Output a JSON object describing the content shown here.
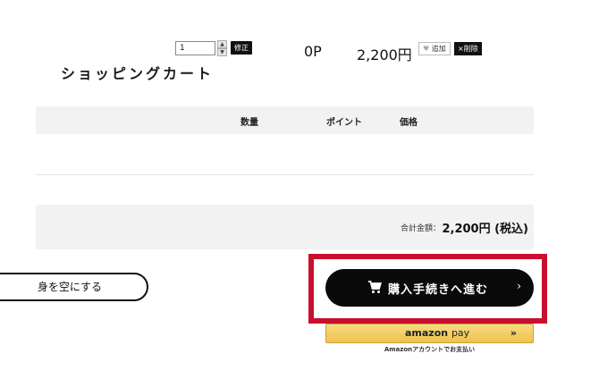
{
  "page": {
    "title": "ショッピングカート"
  },
  "table": {
    "headers": {
      "quantity": "数量",
      "points": "ポイント",
      "price": "価格"
    },
    "items": [
      {
        "quantity": "1",
        "update_label": "修正",
        "points": "0P",
        "price": "2,200円",
        "favorite_label": "追加",
        "delete_label": "×削除"
      }
    ]
  },
  "total": {
    "label": "合計金額：",
    "value": "2,200円 (税込)"
  },
  "actions": {
    "clear_cart": "身を空にする",
    "checkout": "購入手続きへ進む",
    "amazon_pay": {
      "brand": "amazon",
      "word": "pay",
      "caption": "Amazonアカウントでお支払い"
    }
  },
  "icons": {
    "cart": "cart-icon",
    "chevron": "chevron-right-icon",
    "heart": "heart-icon",
    "arrows": "double-chevron-icon"
  },
  "colors": {
    "highlight": "#c8102e",
    "checkout_bg": "#0a0a0a",
    "amazon_bg": "#f0c14b",
    "table_head_bg": "#f2f2f2"
  }
}
